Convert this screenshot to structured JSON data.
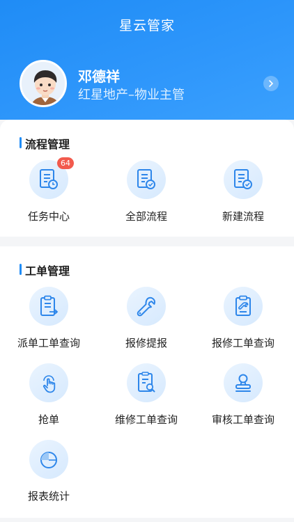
{
  "app": {
    "title": "星云管家"
  },
  "profile": {
    "name": "邓德祥",
    "role": "红星地产–物业主管"
  },
  "flow": {
    "title": "流程管理",
    "items": [
      {
        "label": "任务中心",
        "icon": "task-document-clock-icon",
        "badge": "64"
      },
      {
        "label": "全部流程",
        "icon": "document-check-icon"
      },
      {
        "label": "新建流程",
        "icon": "document-check-icon"
      }
    ]
  },
  "work": {
    "title": "工单管理",
    "items": [
      {
        "label": "派单工单查询",
        "icon": "clipboard-arrow-icon"
      },
      {
        "label": "报修提报",
        "icon": "wrench-icon"
      },
      {
        "label": "报修工单查询",
        "icon": "clipboard-wrench-icon"
      },
      {
        "label": "抢单",
        "icon": "tap-hand-icon"
      },
      {
        "label": "维修工单查询",
        "icon": "document-search-icon"
      },
      {
        "label": "审核工单查询",
        "icon": "stamp-icon"
      },
      {
        "label": "报表统计",
        "icon": "pie-chart-icon"
      }
    ]
  },
  "colors": {
    "primary": "#1f8cf6",
    "badge": "#f25a4d",
    "iconBg": "#e3f0fe"
  }
}
